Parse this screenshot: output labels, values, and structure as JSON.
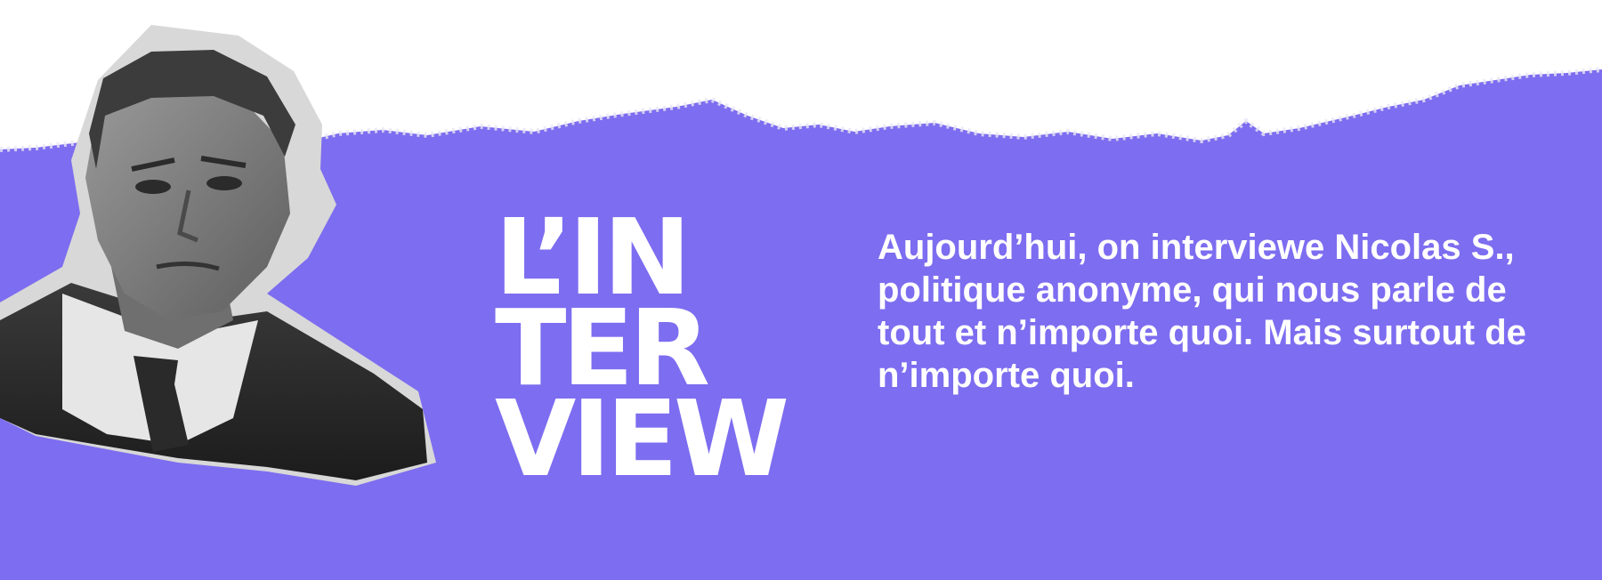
{
  "colors": {
    "accent": "#7d6df0",
    "paper": "#ffffff",
    "text": "#ffffff"
  },
  "portrait": {
    "icon": "grayscale-portrait-cutout"
  },
  "title": {
    "line1": "L’IN",
    "line2": "TER",
    "line3": "VIEW"
  },
  "intro": {
    "text": "Aujourd’hui, on interviewe Nicolas S., politique anonyme, qui nous parle de tout et n’importe quoi. Mais surtout de n’importe quoi."
  }
}
